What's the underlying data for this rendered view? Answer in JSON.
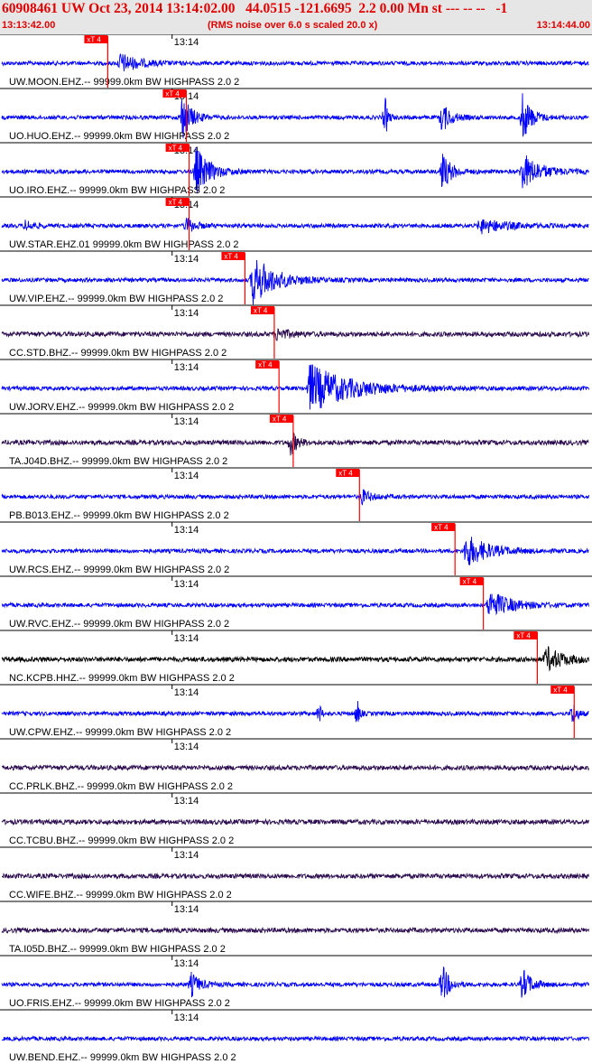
{
  "header": {
    "title": "60908461 UW Oct 23, 2014 13:14:02.00   44.0515 -121.6695  2.2 0.00 Mn st --- -- --   -1",
    "start_time": "13:13:42.00",
    "subtitle": "(RMS noise over 6.0 s scaled 20.0 x)",
    "end_time": "13:14:44.00"
  },
  "colors": {
    "blue": "#0000ff",
    "purple": "#2b0c4f",
    "black": "#000000",
    "pick": "#ff0000",
    "header_bg": "#e6e6e6",
    "header_text": "#e00000"
  },
  "chart_data": {
    "type": "seismogram",
    "title": "60908461 UW Oct 23, 2014 13:14:02.00   44.0515 -121.6695  2.2 0.00 Mn st --- -- --   -1",
    "subtitle": "(RMS noise over 6.0 s scaled 20.0 x)",
    "time_window_s": [
      0,
      62
    ],
    "time_start_label": "13:13:42.00",
    "time_end_label": "13:14:44.00",
    "minute_mark": {
      "label": "13:14",
      "time_s": 18
    },
    "pick_label": "xT 4",
    "traces": [
      {
        "label": "UW.MOON.EHZ.-- 99999.0km BW  HIGHPASS  2.0  2",
        "color": "blue",
        "pick_s": 11.2,
        "bursts": [
          {
            "t": 12.5,
            "amp": 1.2,
            "dur": 4
          }
        ]
      },
      {
        "label": "UO.HUO.EHZ.-- 99999.0km BW  HIGHPASS  2.0  2",
        "color": "blue",
        "pick_s": 19.5,
        "bursts": [
          {
            "t": 19,
            "amp": 3,
            "dur": 2
          },
          {
            "t": 40.5,
            "amp": 2.5,
            "dur": 0.6
          },
          {
            "t": 46.5,
            "amp": 1.8,
            "dur": 2
          },
          {
            "t": 55,
            "amp": 3,
            "dur": 2
          }
        ]
      },
      {
        "label": "UO.IRO.EHZ.-- 99999.0km BW  HIGHPASS  2.0  2",
        "color": "blue",
        "pick_s": 19.8,
        "bursts": [
          {
            "t": 20.5,
            "amp": 3,
            "dur": 3
          },
          {
            "t": 46.5,
            "amp": 2.5,
            "dur": 2
          },
          {
            "t": 55,
            "amp": 2.2,
            "dur": 4
          }
        ]
      },
      {
        "label": "UW.STAR.EHZ.01 99999.0km BW  HIGHPASS  2.0  2",
        "color": "blue",
        "pick_s": 19.8,
        "bursts": [
          {
            "t": 2.5,
            "amp": 0.6,
            "dur": 2
          },
          {
            "t": 19.5,
            "amp": 1,
            "dur": 2
          },
          {
            "t": 50.5,
            "amp": 0.9,
            "dur": 6
          }
        ]
      },
      {
        "label": "UW.VIP.EHZ.-- 99999.0km BW  HIGHPASS  2.0  2",
        "color": "blue",
        "pick_s": 25.7,
        "bursts": [
          {
            "t": 26.5,
            "amp": 3,
            "dur": 5
          }
        ]
      },
      {
        "label": "CC.STD.BHZ.-- 99999.0km BW  HIGHPASS  2.0  2",
        "color": "purple",
        "pick_s": 28.8,
        "bursts": [
          {
            "t": 29,
            "amp": 0.7,
            "dur": 3
          }
        ]
      },
      {
        "label": "UW.JORV.EHZ.-- 99999.0km BW  HIGHPASS  2.0  2",
        "color": "blue",
        "pick_s": 29.3,
        "bursts": [
          {
            "t": 32.5,
            "amp": 3,
            "dur": 9
          }
        ]
      },
      {
        "label": "TA.J04D.BHZ.-- 99999.0km BW  HIGHPASS  2.0  2",
        "color": "purple",
        "pick_s": 30.8,
        "bursts": [
          {
            "t": 30.5,
            "amp": 1.6,
            "dur": 1.5
          }
        ]
      },
      {
        "label": "PB.B013.EHZ.-- 99999.0km BW  HIGHPASS  2.0  2",
        "color": "blue",
        "pick_s": 37.8,
        "bursts": [
          {
            "t": 38,
            "amp": 0.9,
            "dur": 2
          }
        ]
      },
      {
        "label": "UW.RCS.EHZ.-- 99999.0km BW  HIGHPASS  2.0  2",
        "color": "blue",
        "pick_s": 47.9,
        "bursts": [
          {
            "t": 49,
            "amp": 2,
            "dur": 5
          }
        ]
      },
      {
        "label": "UW.RVC.EHZ.-- 99999.0km BW  HIGHPASS  2.0  2",
        "color": "blue",
        "pick_s": 50.9,
        "bursts": [
          {
            "t": 51.5,
            "amp": 1.7,
            "dur": 5
          }
        ]
      },
      {
        "label": "NC.KCPB.HHZ.-- 99999.0km BW  HIGHPASS  2.0  2",
        "color": "black",
        "pick_s": 56.6,
        "bursts": [
          {
            "t": 57.5,
            "amp": 1.5,
            "dur": 4
          }
        ]
      },
      {
        "label": "UW.CPW.EHZ.-- 99999.0km BW  HIGHPASS  2.0  2",
        "color": "blue",
        "pick_s": 60.5,
        "bursts": [
          {
            "t": 33.5,
            "amp": 1.5,
            "dur": 0.5
          },
          {
            "t": 37.5,
            "amp": 2,
            "dur": 0.5
          },
          {
            "t": 60.3,
            "amp": 1.6,
            "dur": 1
          }
        ]
      },
      {
        "label": "CC.PRLK.BHZ.-- 99999.0km BW  HIGHPASS  2.0  2",
        "color": "purple",
        "pick_s": null,
        "bursts": []
      },
      {
        "label": "CC.TCBU.BHZ.-- 99999.0km BW  HIGHPASS  2.0  2",
        "color": "purple",
        "pick_s": null,
        "bursts": []
      },
      {
        "label": "CC.WIFE.BHZ.-- 99999.0km BW  HIGHPASS  2.0  2",
        "color": "purple",
        "pick_s": null,
        "bursts": []
      },
      {
        "label": "TA.I05D.BHZ.-- 99999.0km BW  HIGHPASS  2.0  2",
        "color": "purple",
        "pick_s": null,
        "bursts": []
      },
      {
        "label": "UO.FRIS.EHZ.-- 99999.0km BW  HIGHPASS  2.0  2",
        "color": "blue",
        "pick_s": null,
        "bursts": [
          {
            "t": 20,
            "amp": 1.4,
            "dur": 2
          },
          {
            "t": 46.5,
            "amp": 2.5,
            "dur": 1.5
          },
          {
            "t": 55,
            "amp": 2,
            "dur": 2
          }
        ]
      },
      {
        "label": "UW.BEND.EHZ.-- 99999.0km BW  HIGHPASS  2.0  2",
        "color": "blue",
        "pick_s": null,
        "bursts": []
      }
    ]
  }
}
